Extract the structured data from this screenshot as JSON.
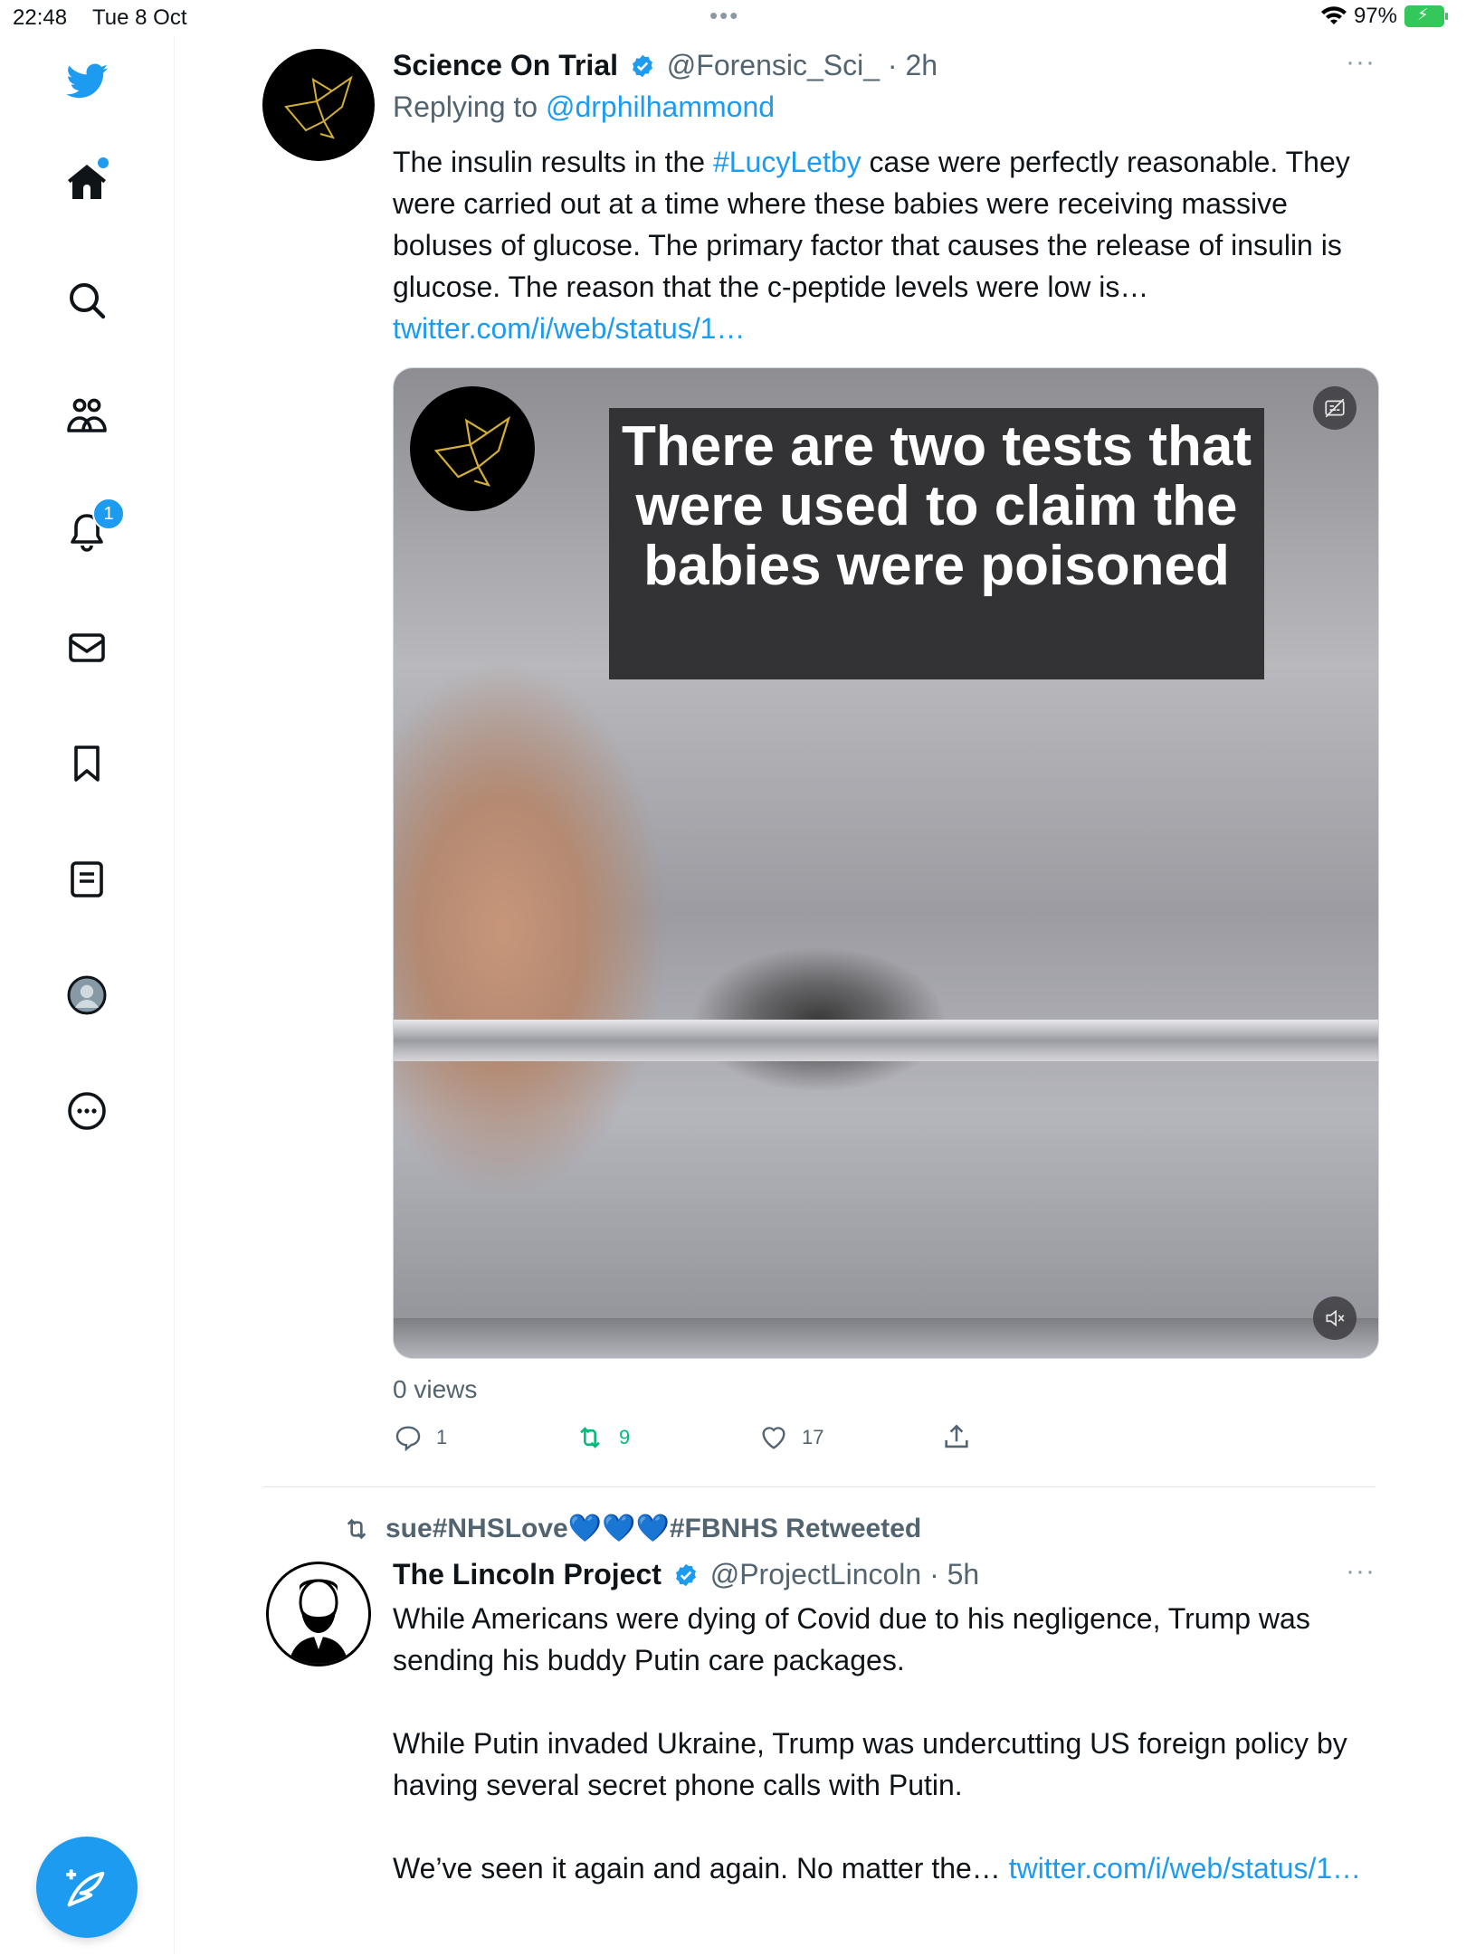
{
  "status_bar": {
    "time": "22:48",
    "date": "Tue 8 Oct",
    "dots": "•••",
    "battery": "97%"
  },
  "sidebar": {
    "notification_count": "1"
  },
  "tweet1": {
    "name": "Science On Trial",
    "handle": "@Forensic_Sci_",
    "time": "· 2h",
    "more": "···",
    "replying_prefix": "Replying to",
    "replying_handle": "@drphilhammond",
    "text_before_tag": "The insulin results in the ",
    "hashtag": "#LucyLetby",
    "text_after_tag": " case were perfectly reasonable. They were carried out at a time where these babies were receiving massive boluses of glucose. The primary factor that causes the release of insulin is glucose. The reason that the c-peptide levels were low is…",
    "link": "twitter.com/i/web/status/1…",
    "video_caption": "There are two tests that were used to claim the babies were poisoned",
    "views": "0 views",
    "replies": "1",
    "retweets": "9",
    "likes": "17"
  },
  "retweet_banner": {
    "user": "sue#NHSLove",
    "hearts": "💙💙💙",
    "suffix": "#FBNHS Retweeted"
  },
  "tweet2": {
    "name": "The Lincoln Project",
    "handle": "@ProjectLincoln",
    "time": "· 5h",
    "more": "···",
    "para1": "While Americans were dying of Covid due to his negligence, Trump was sending his buddy Putin care packages.",
    "para2": "While Putin invaded Ukraine, Trump was undercutting US foreign policy by having several secret phone calls with Putin.",
    "para3": "We’ve seen it again and again. No matter the… ",
    "link": "twitter.com/i/web/status/1…"
  },
  "colors": {
    "accent": "#1d9bf0",
    "retweet": "#00ba7c",
    "muted": "#536471"
  }
}
